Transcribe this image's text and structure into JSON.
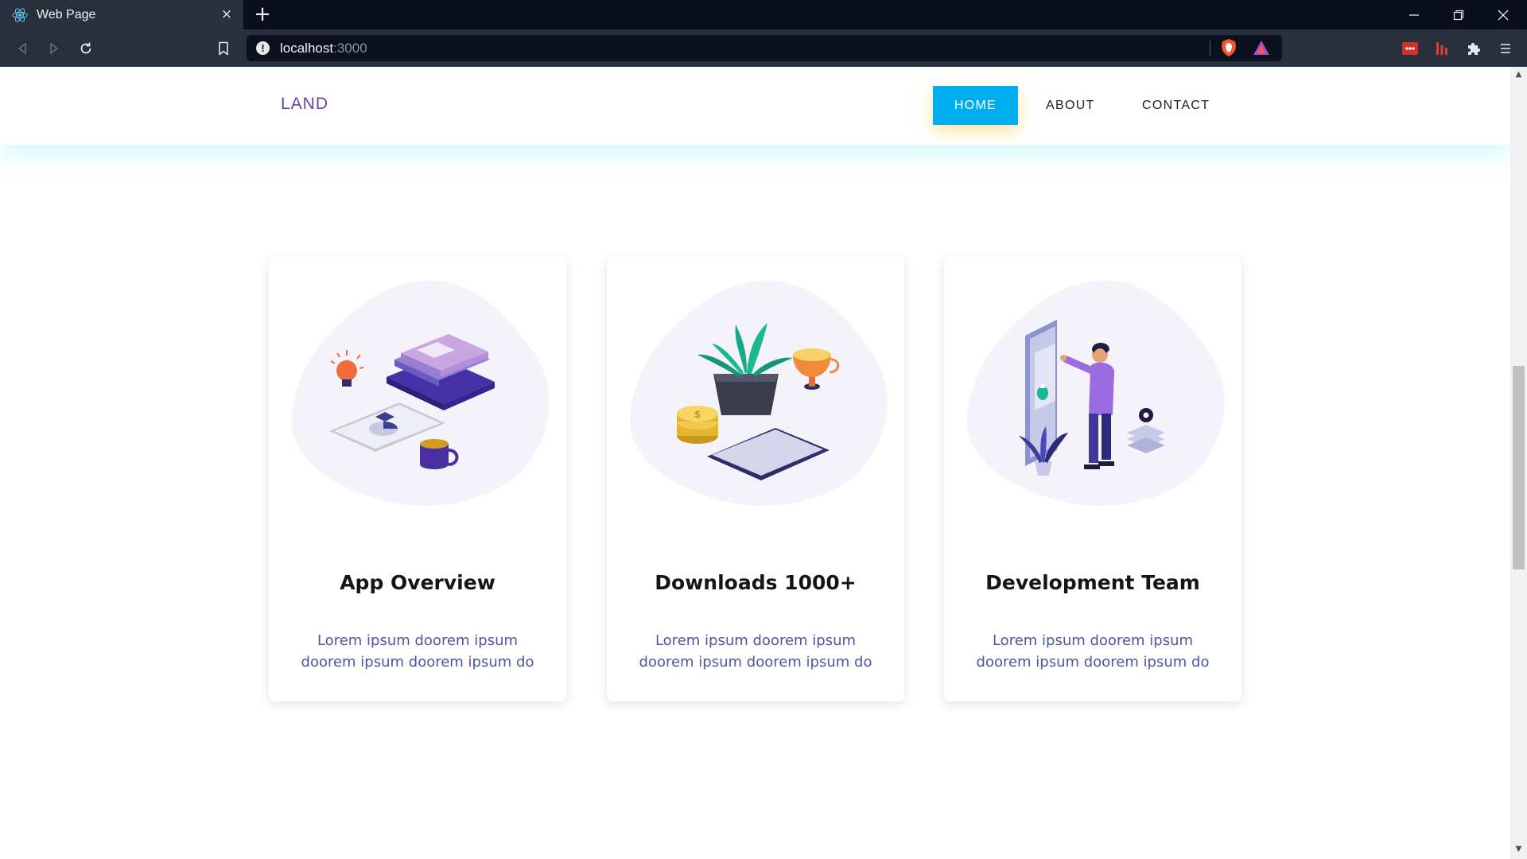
{
  "browser": {
    "tab_title": "Web Page",
    "tab_close": "×",
    "new_tab": "+",
    "url_host": "localhost",
    "url_port": ":3000",
    "info_glyph": "!",
    "icons": [
      "react-favicon-icon",
      "back-icon",
      "forward-icon",
      "reload-icon",
      "bookmark-icon",
      "site-info-icon",
      "brave-shields-icon",
      "brave-rewards-icon",
      "extension-red-icon",
      "extension-bars-icon",
      "extensions-puzzle-icon",
      "menu-icon",
      "minimize-icon",
      "restore-icon",
      "close-window-icon"
    ]
  },
  "header": {
    "logo": "LAND",
    "nav": {
      "home": "HOME",
      "about": "ABOUT",
      "contact": "CONTACT"
    },
    "active_color": "#00aef0",
    "logo_color": "#6c3fa8"
  },
  "cards": [
    {
      "title": "App Overview",
      "text": "Lorem ipsum doorem ipsum doorem ipsum doorem ipsum do"
    },
    {
      "title": "Downloads 1000+",
      "text": "Lorem ipsum doorem ipsum doorem ipsum doorem ipsum do"
    },
    {
      "title": "Development Team",
      "text": "Lorem ipsum doorem ipsum doorem ipsum doorem ipsum do"
    }
  ],
  "colors": {
    "card_text": "#4d56a3",
    "blob": "#f4f3fa",
    "accent_purple": "#8b5cd8"
  }
}
